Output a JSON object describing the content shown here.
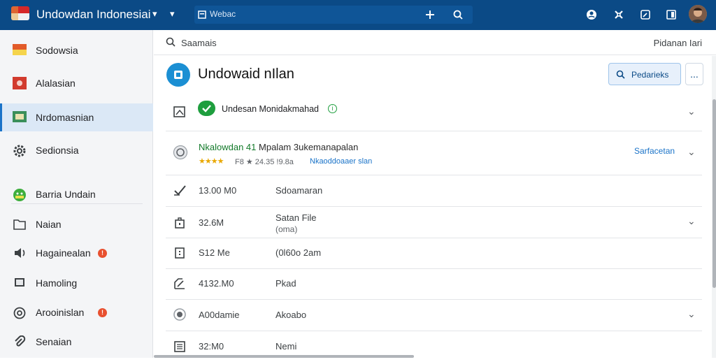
{
  "topbar": {
    "app_title": "Undowdan Indonesiai",
    "tab_label": "Webac",
    "icons": [
      "flag-icon",
      "chevron-down-icon",
      "chevron-down-icon",
      "tab-icon",
      "plus-icon",
      "search-icon",
      "help-icon",
      "settings-icon",
      "edit-icon",
      "window-icon",
      "avatar"
    ]
  },
  "search": {
    "label": "Saamais",
    "right_label": "Pidanan Iari"
  },
  "sidebar": {
    "items": [
      {
        "label": "Sodowsia",
        "icon": "flag-icon"
      },
      {
        "label": "Alalasian",
        "icon": "flag-icon"
      },
      {
        "label": "Nrdomasnian",
        "icon": "flag-icon",
        "active": true
      },
      {
        "label": "Sedionsia",
        "icon": "gear-icon"
      },
      {
        "label": "Barria Undain",
        "icon": "android-icon"
      },
      {
        "label": "Naian",
        "icon": "folder-icon"
      },
      {
        "label": "Hagainealan",
        "icon": "speaker-icon",
        "badge": "!"
      },
      {
        "label": "Hamoling",
        "icon": "monitor-icon"
      },
      {
        "label": "Arooinislan",
        "icon": "at-icon",
        "badge": "!"
      },
      {
        "label": "Senaian",
        "icon": "paperclip-icon"
      }
    ]
  },
  "main": {
    "title": "Undowaid nIlan",
    "primary_button": "Pedarieks",
    "more_button": "...",
    "status_row": {
      "text": "Undesan Monidakmahad",
      "info": "i"
    },
    "highlight_row": {
      "title_green": "Nkalowdan 41",
      "title_rest": "Mpalam 3ukemanapalan",
      "stars": "★★★★",
      "meta": "F8 ★ 24.35 !9.8a",
      "link": "Nkaoddoaaer slan",
      "side_link": "Sarfacetan"
    },
    "rows": [
      {
        "size": "13.00 M0",
        "name": "Sdoamaran",
        "sub": ""
      },
      {
        "size": "32.6M",
        "name": "Satan File",
        "sub": "(oma)"
      },
      {
        "size": "S12 Me",
        "name": "(0l60o 2am",
        "sub": ""
      },
      {
        "size": "4132.M0",
        "name": "Pkad",
        "sub": ""
      },
      {
        "size": "A00damie",
        "name": "Akoabo",
        "sub": ""
      },
      {
        "size": "32:M0",
        "name": "Nemi",
        "sub": ""
      }
    ]
  },
  "colors": {
    "topbar": "#0b4a86",
    "accent": "#1a73c8",
    "success": "#1e9e3e",
    "badge": "#e8502f"
  }
}
